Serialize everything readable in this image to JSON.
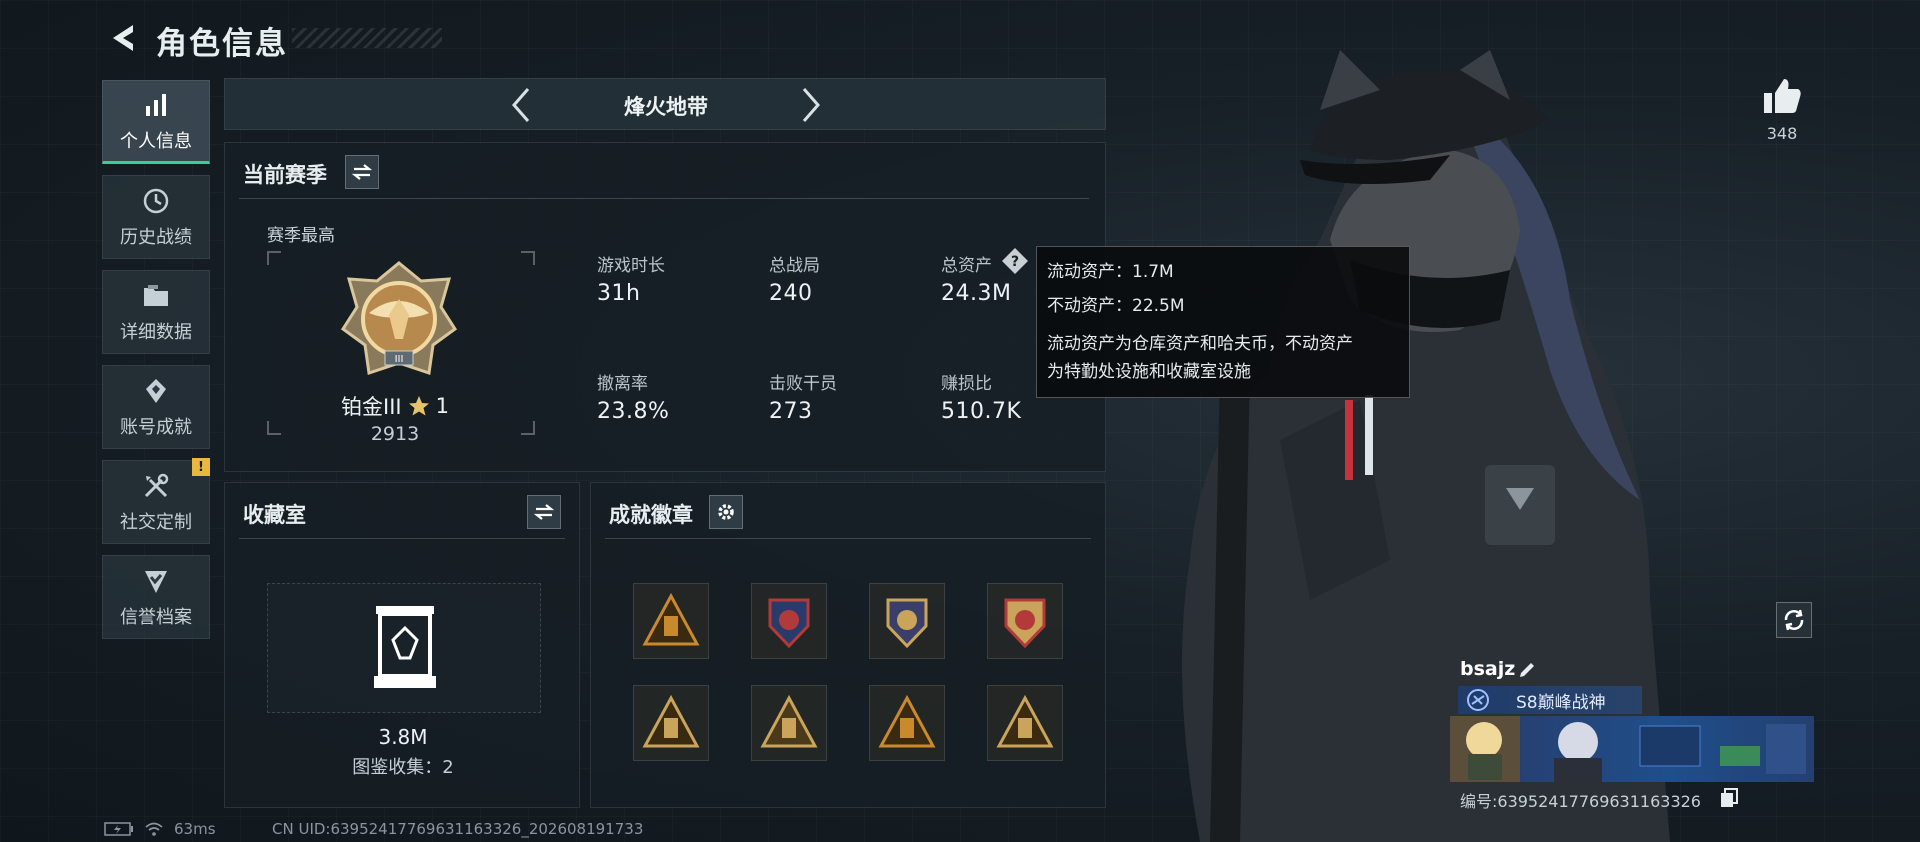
{
  "header": {
    "title": "角色信息",
    "back_icon": "back-arrow-icon"
  },
  "sidebar": {
    "items": [
      {
        "label": "个人信息",
        "icon": "bar-chart-icon",
        "active": true
      },
      {
        "label": "历史战绩",
        "icon": "clock-icon",
        "active": false
      },
      {
        "label": "详细数据",
        "icon": "folder-icon",
        "active": false
      },
      {
        "label": "账号成就",
        "icon": "medal-icon",
        "active": false
      },
      {
        "label": "社交定制",
        "icon": "tools-icon",
        "active": false,
        "notice": "!"
      },
      {
        "label": "信誉档案",
        "icon": "shield-check-icon",
        "active": false
      }
    ]
  },
  "mode_selector": {
    "label": "烽火地带"
  },
  "season": {
    "title": "当前赛季",
    "best_label": "赛季最高",
    "rank_name": "铂金III",
    "rank_stars": "1",
    "rank_score": "2913",
    "stats": [
      {
        "label": "游戏时长",
        "value": "31h"
      },
      {
        "label": "总战局",
        "value": "240"
      },
      {
        "label": "总资产",
        "value": "24.3M",
        "has_help": true
      },
      {
        "label": "撤离率",
        "value": "23.8%"
      },
      {
        "label": "击败干员",
        "value": "273"
      },
      {
        "label": "赚损比",
        "value": "510.7K"
      }
    ]
  },
  "tooltip": {
    "line1": "流动资产：1.7M",
    "line2": "不动资产：22.5M",
    "desc1": "流动资产为仓库资产和哈夫币，不动资产",
    "desc2": "为特勤处设施和收藏室设施"
  },
  "collection": {
    "title": "收藏室",
    "value": "3.8M",
    "count_text": "图鉴收集：2"
  },
  "achievements": {
    "title": "成就徽章",
    "badges": [
      {
        "name": "badge-1"
      },
      {
        "name": "badge-2"
      },
      {
        "name": "badge-3"
      },
      {
        "name": "badge-4"
      },
      {
        "name": "badge-5"
      },
      {
        "name": "badge-6"
      },
      {
        "name": "badge-7"
      },
      {
        "name": "badge-8"
      }
    ]
  },
  "likes": {
    "count": "348"
  },
  "player": {
    "name": "bsajz",
    "title": "S8巅峰战神",
    "id_text": "编号:6395241776963116332​6"
  },
  "footer": {
    "ping": "63ms",
    "uid": "CN UID:6395241776963116332​6_202608191733"
  },
  "colors": {
    "accent": "#33d197",
    "notice": "#e9b93c",
    "gold": "#c9a45a"
  }
}
